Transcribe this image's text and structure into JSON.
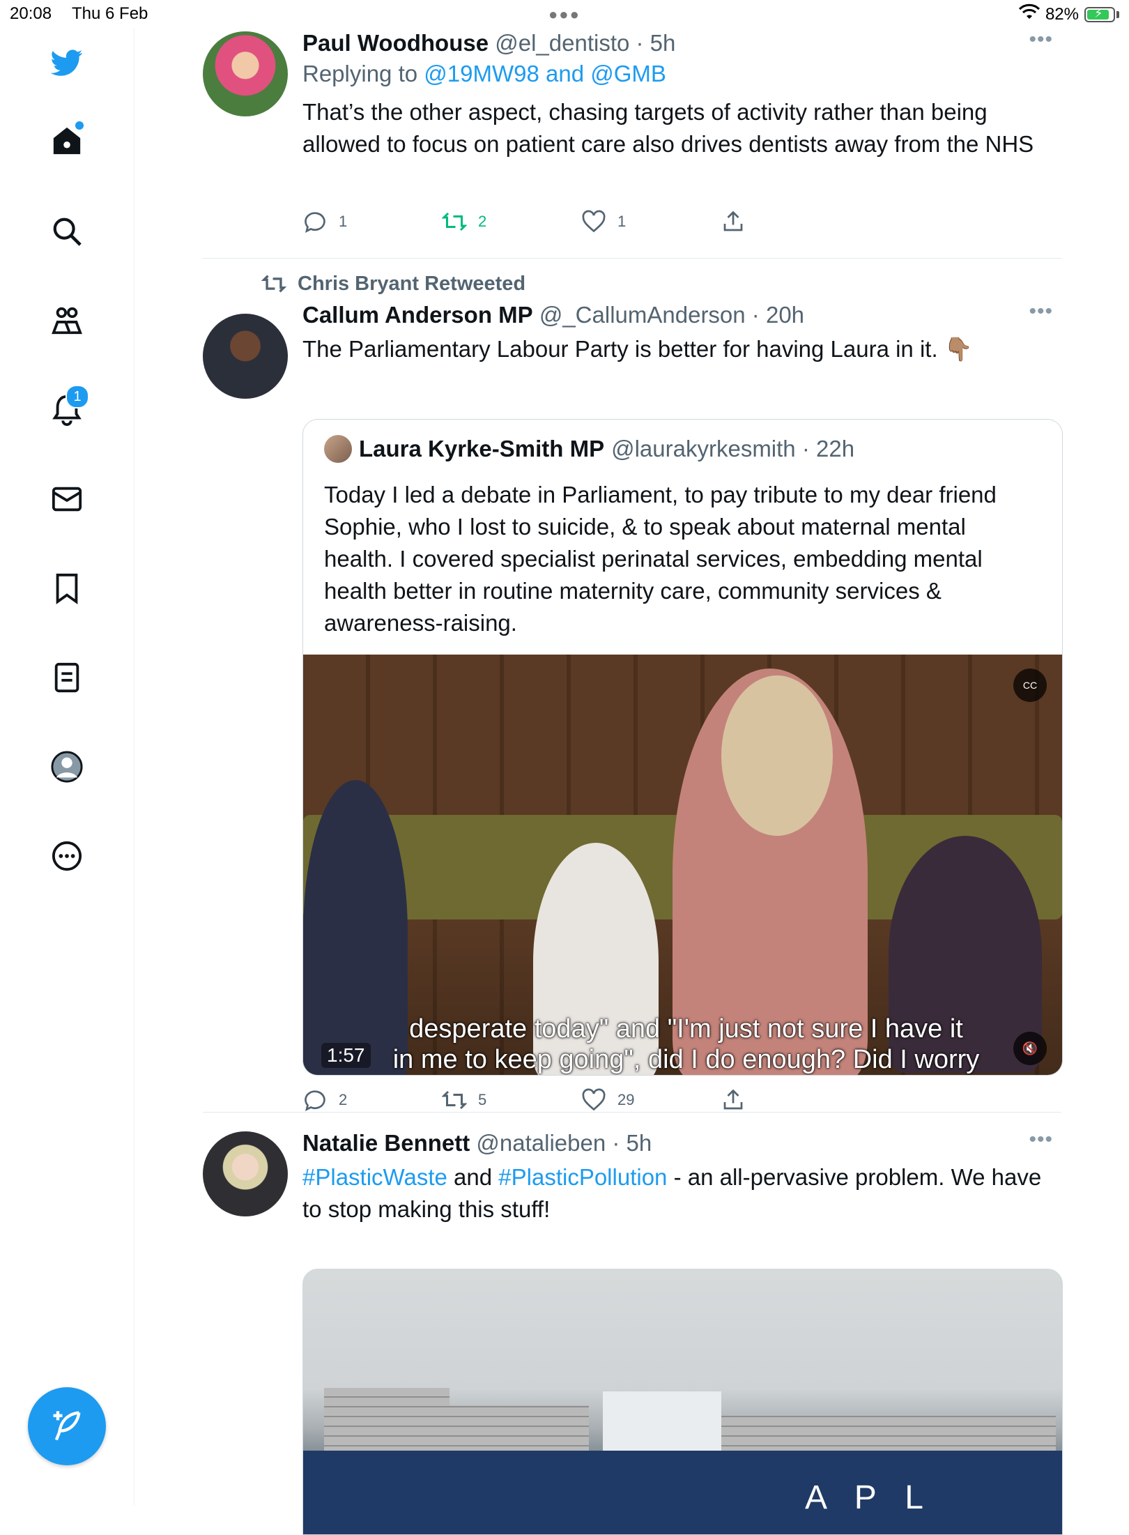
{
  "status_bar": {
    "time": "20:08",
    "date": "Thu 6 Feb",
    "battery": "82%"
  },
  "sidebar": {
    "notifications_badge": "1",
    "items": [
      "twitter-logo",
      "home",
      "explore",
      "communities",
      "notifications",
      "messages",
      "bookmarks",
      "lists",
      "profile",
      "more"
    ]
  },
  "tweets": [
    {
      "name": "Paul Woodhouse",
      "handle": "@el_dentisto · 5h",
      "replying_prefix": "Replying to ",
      "replying_to": "@19MW98 and @GMB",
      "text": "That’s the other aspect, chasing targets of activity rather than being allowed to focus on patient care also drives dentists away from the NHS",
      "replies": "1",
      "retweets": "2",
      "likes": "1"
    },
    {
      "retweeted_by": "Chris Bryant Retweeted",
      "name": "Callum Anderson MP",
      "handle": "@_CallumAnderson · 20h",
      "text": "The Parliamentary Labour Party is better for having Laura in it. 👇🏽",
      "quote": {
        "name": "Laura Kyrke-Smith MP",
        "handle": "@laurakyrkesmith · 22h",
        "text": "Today I led a debate in Parliament, to pay tribute to my dear friend Sophie, who I lost to suicide, & to speak about maternal mental health. I covered specialist perinatal services, embedding mental health better in routine maternity care, community services & awareness-raising.",
        "video_caption_1": "desperate today\" and \"I'm just not sure I have it",
        "video_caption_2": "in me to keep going\", did I do enough? Did I worry",
        "video_time": "1:57",
        "cc_label": "CC"
      },
      "replies": "2",
      "retweets": "5",
      "likes": "29"
    },
    {
      "name": "Natalie Bennett",
      "handle": "@natalieben · 5h",
      "hashtag1": "#PlasticWaste",
      "and": " and ",
      "hashtag2": "#PlasticPollution",
      "text_rest": " - an all-pervasive problem. We have to stop making this stuff!",
      "photo_text": "A P L"
    }
  ],
  "colors": {
    "accent": "#1d9bf0",
    "retweet_green": "#00ba7c",
    "secondary_text": "#536471"
  }
}
